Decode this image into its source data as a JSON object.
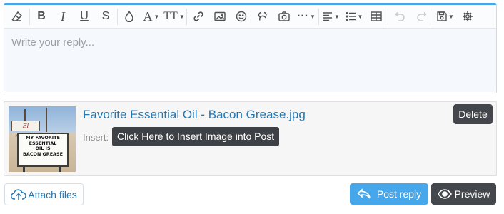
{
  "toolbar": {
    "buttons": [
      {
        "name": "remove-format",
        "icon": "eraser-icon"
      },
      {
        "name": "bold",
        "label": "B"
      },
      {
        "name": "italic",
        "label": "I"
      },
      {
        "name": "underline",
        "label": "U"
      },
      {
        "name": "strikethrough",
        "label": "S"
      },
      {
        "name": "text-color",
        "icon": "droplet-icon"
      },
      {
        "name": "font-family",
        "label": "A"
      },
      {
        "name": "font-size",
        "label": "TT"
      },
      {
        "name": "insert-link",
        "icon": "link-icon"
      },
      {
        "name": "insert-image",
        "icon": "image-icon"
      },
      {
        "name": "smilies",
        "icon": "smiley-icon"
      },
      {
        "name": "gif",
        "icon": "gif-icon"
      },
      {
        "name": "media",
        "icon": "camera-icon"
      },
      {
        "name": "more-options",
        "label": "···"
      },
      {
        "name": "align",
        "icon": "align-icon"
      },
      {
        "name": "list",
        "icon": "list-icon"
      },
      {
        "name": "table",
        "icon": "table-icon"
      },
      {
        "name": "undo",
        "icon": "undo-icon",
        "disabled": true
      },
      {
        "name": "redo",
        "icon": "redo-icon",
        "disabled": true
      },
      {
        "name": "drafts",
        "icon": "save-icon"
      },
      {
        "name": "settings",
        "icon": "gear-icon"
      }
    ],
    "bold_label": "B",
    "italic_label": "I",
    "underline_label": "U",
    "strike_label": "S",
    "font_label": "A",
    "size_label": "TT",
    "more_label": "···"
  },
  "editor": {
    "placeholder": "Write your reply..."
  },
  "attachment": {
    "file_name": "Favorite Essential Oil - Bacon Grease.jpg",
    "insert_label": "Insert:",
    "tooltip": "Click Here to Insert Image into Post",
    "delete_label": "Delete",
    "thumbnail": {
      "sign_top": "El Arroyo",
      "sign_lines": [
        "MY FAVORITE",
        "ESSENTIAL",
        "OIL IS",
        "BACON GREASE"
      ]
    }
  },
  "actions": {
    "attach_files": "Attach files",
    "post_reply": "Post reply",
    "preview": "Preview"
  },
  "colors": {
    "accent": "#47a7eb",
    "link": "#2577b1",
    "dark_button": "#43464a"
  }
}
